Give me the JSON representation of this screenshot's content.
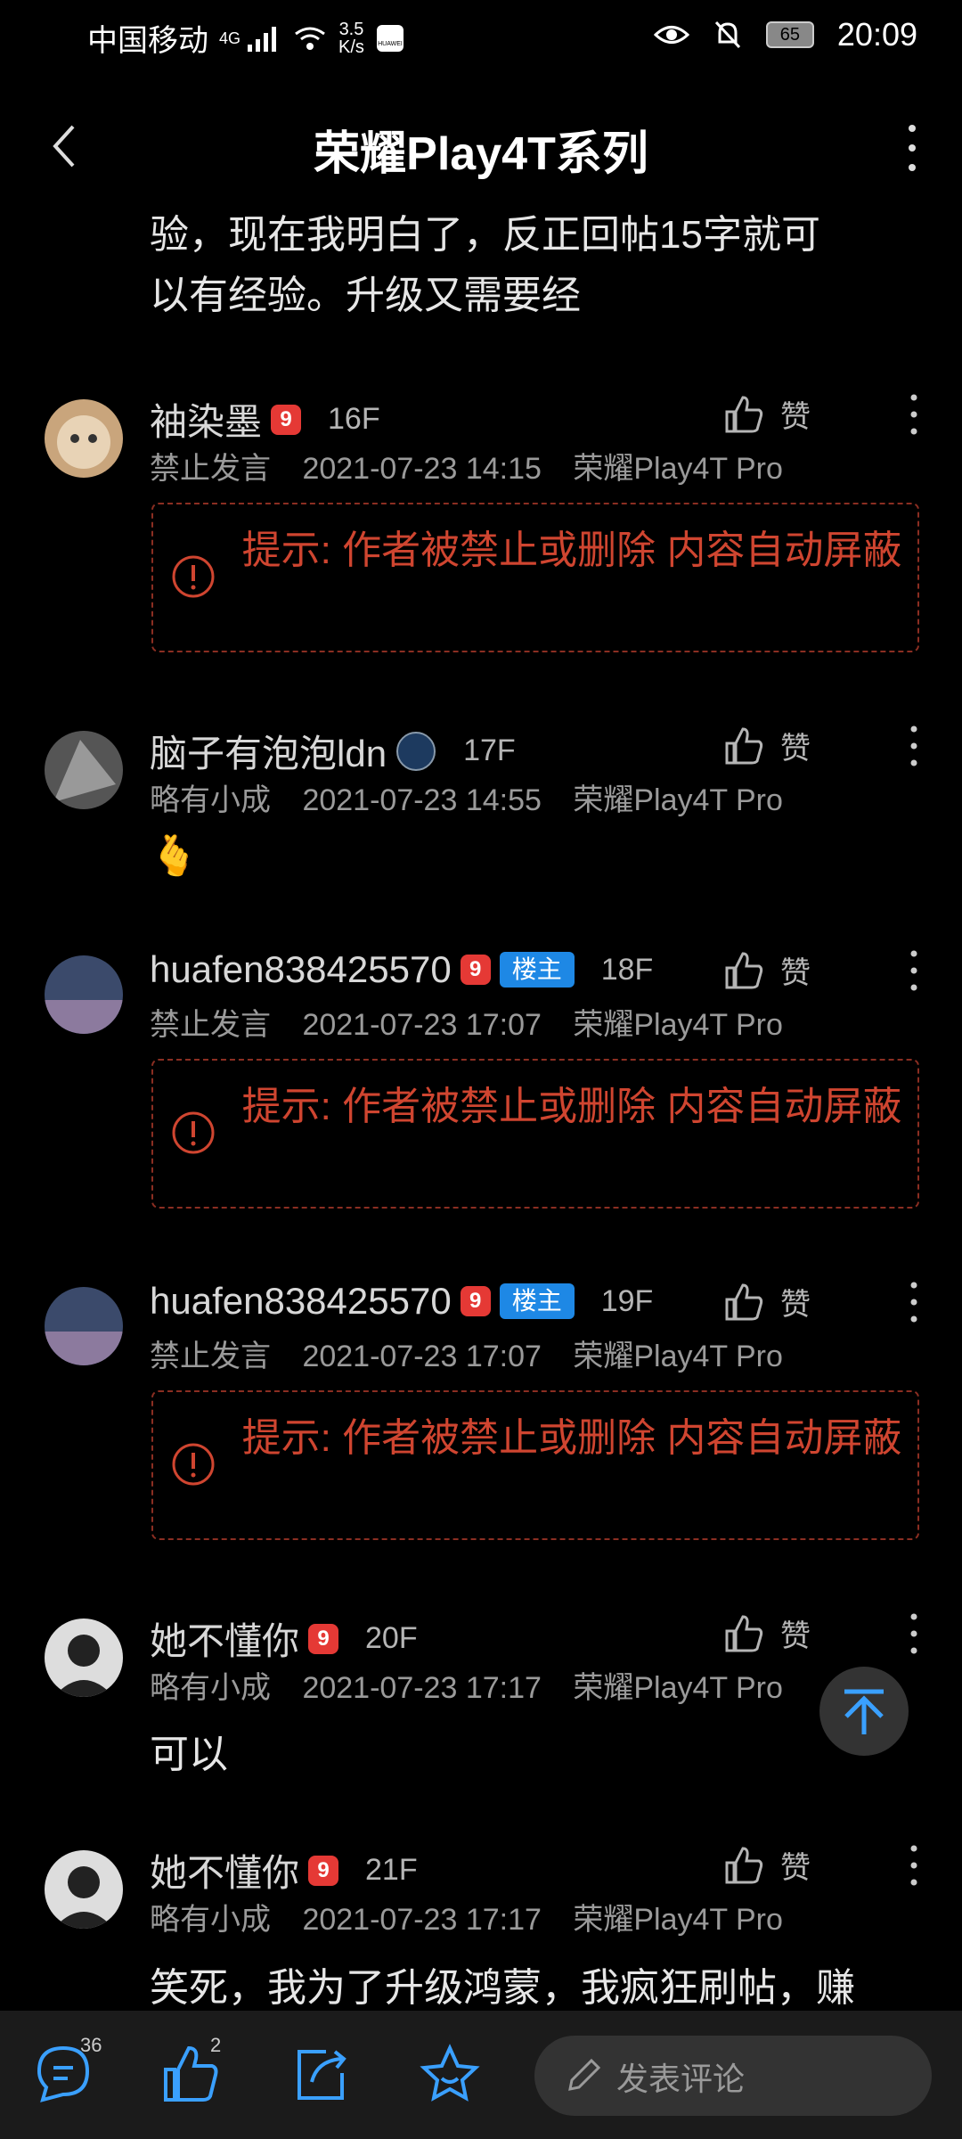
{
  "status_bar": {
    "carrier": "中国移动",
    "network_type": "4G",
    "speed_value": "3.5",
    "speed_unit": "K/s",
    "app_label": "HUAWEI",
    "battery": "65",
    "time": "20:09"
  },
  "header": {
    "title": "荣耀Play4T系列"
  },
  "post_tail": {
    "line1": "验，现在我明白了，反正回帖15字就可",
    "line2": "以有经验。升级又需要经"
  },
  "posts": [
    {
      "username": "袖染墨",
      "level": "9",
      "owner": "",
      "floor": "16F",
      "status": "禁止发言",
      "time": "2021-07-23 14:15",
      "device": "荣耀Play4T Pro",
      "like_label": "赞",
      "blocked_msg": "提示: 作者被禁止或删除 内容自动屏蔽",
      "content": ""
    },
    {
      "username": "脑子有泡泡ldn",
      "level": "",
      "owner": "",
      "floor": "17F",
      "status": "略有小成",
      "time": "2021-07-23 14:55",
      "device": "荣耀Play4T Pro",
      "like_label": "赞",
      "blocked_msg": "",
      "content": "🫰"
    },
    {
      "username": "huafen838425570",
      "level": "9",
      "owner": "楼主",
      "floor": "18F",
      "status": "禁止发言",
      "time": "2021-07-23 17:07",
      "device": "荣耀Play4T Pro",
      "like_label": "赞",
      "blocked_msg": "提示: 作者被禁止或删除 内容自动屏蔽",
      "content": ""
    },
    {
      "username": "huafen838425570",
      "level": "9",
      "owner": "楼主",
      "floor": "19F",
      "status": "禁止发言",
      "time": "2021-07-23 17:07",
      "device": "荣耀Play4T Pro",
      "like_label": "赞",
      "blocked_msg": "提示: 作者被禁止或删除 内容自动屏蔽",
      "content": ""
    },
    {
      "username": "她不懂你",
      "level": "9",
      "owner": "",
      "floor": "20F",
      "status": "略有小成",
      "time": "2021-07-23 17:17",
      "device": "荣耀Play4T Pro",
      "like_label": "赞",
      "blocked_msg": "",
      "content": "可以"
    },
    {
      "username": "她不懂你",
      "level": "9",
      "owner": "",
      "floor": "21F",
      "status": "略有小成",
      "time": "2021-07-23 17:17",
      "device": "荣耀Play4T Pro",
      "like_label": "赞",
      "blocked_msg": "",
      "content": "笑死，我为了升级鸿蒙，我疯狂刷帖，赚"
    }
  ],
  "bottom_bar": {
    "comments_count": "36",
    "likes_count": "2",
    "comment_placeholder": "发表评论"
  },
  "colors": {
    "warning": "#cf4530",
    "owner_badge": "#1e88e5",
    "level_badge": "#e53935"
  }
}
